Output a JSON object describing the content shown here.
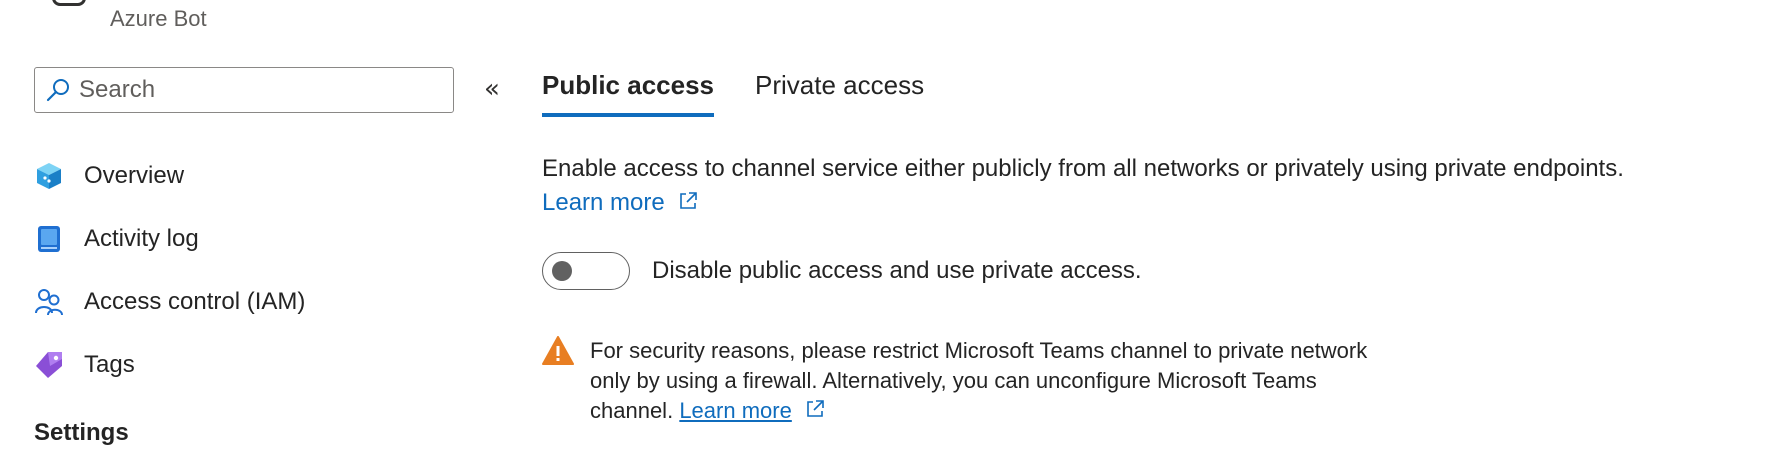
{
  "header": {
    "resource_type": "Azure Bot"
  },
  "sidebar": {
    "search": {
      "placeholder": "Search",
      "value": ""
    },
    "collapse_glyph": "«",
    "items": [
      {
        "label": "Overview",
        "icon": "overview-cube-icon"
      },
      {
        "label": "Activity log",
        "icon": "activity-log-icon"
      },
      {
        "label": "Access control (IAM)",
        "icon": "people-icon"
      },
      {
        "label": "Tags",
        "icon": "tag-icon"
      }
    ],
    "section_heading": "Settings"
  },
  "tabs": [
    {
      "label": "Public access",
      "active": true
    },
    {
      "label": "Private access",
      "active": false
    }
  ],
  "content": {
    "description": "Enable access to channel service either publicly from all networks or privately using private endpoints.",
    "learn_more": "Learn more",
    "toggle": {
      "label": "Disable public access and use private access.",
      "on": false
    },
    "warning": {
      "text": "For security reasons, please restrict Microsoft Teams channel to private network only by using a firewall. Alternatively, you can unconfigure Microsoft Teams channel.",
      "link": "Learn more"
    }
  },
  "colors": {
    "accent": "#0f6cbd",
    "warning": "#e87e22",
    "text": "#242424"
  }
}
